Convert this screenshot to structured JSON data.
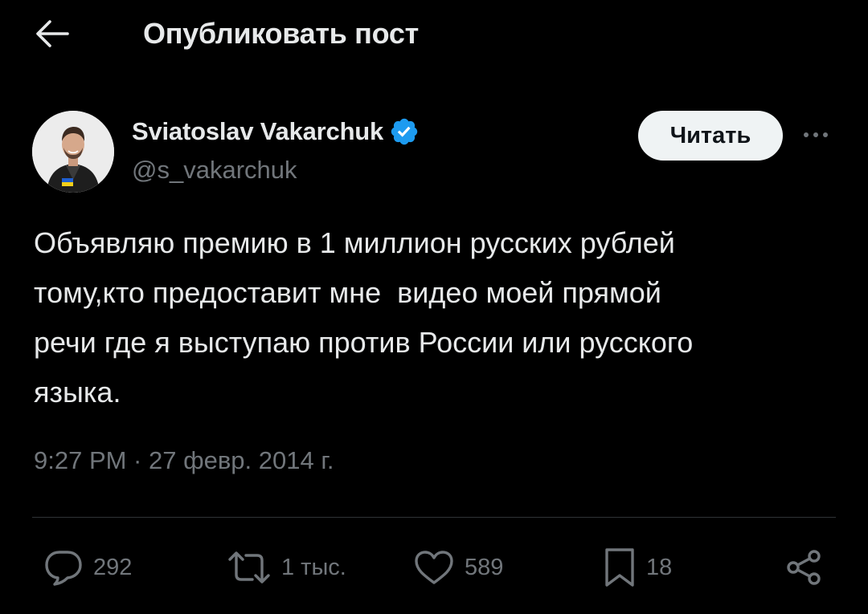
{
  "header": {
    "title": "Опубликовать пост"
  },
  "author": {
    "name": "Sviatoslav Vakarchuk",
    "handle": "@s_vakarchuk",
    "verified": true,
    "follow_label": "Читать"
  },
  "tweet": {
    "text": "Объявляю премию в 1 миллион русских рублей\nтому,кто предоставит мне  видео моей прямой\nречи где я выступаю против России или русского\nязыка.",
    "timestamp": "9:27 PM · 27 февр. 2014 г."
  },
  "actions": {
    "replies": "292",
    "reposts": "1 тыс.",
    "likes": "589",
    "bookmarks": "18"
  },
  "icons": {
    "back": "arrow-left-icon",
    "verified": "verified-badge-icon",
    "more": "more-horizontal-icon",
    "reply": "speech-bubble-icon",
    "repost": "repost-arrows-icon",
    "like": "heart-icon",
    "bookmark": "bookmark-icon",
    "share": "share-nodes-icon"
  },
  "colors": {
    "background": "#000000",
    "text_primary": "#e7e9ea",
    "text_secondary": "#71767b",
    "verified_blue": "#1d9bf0",
    "follow_button_bg": "#eff3f4",
    "divider": "#2f3336"
  }
}
